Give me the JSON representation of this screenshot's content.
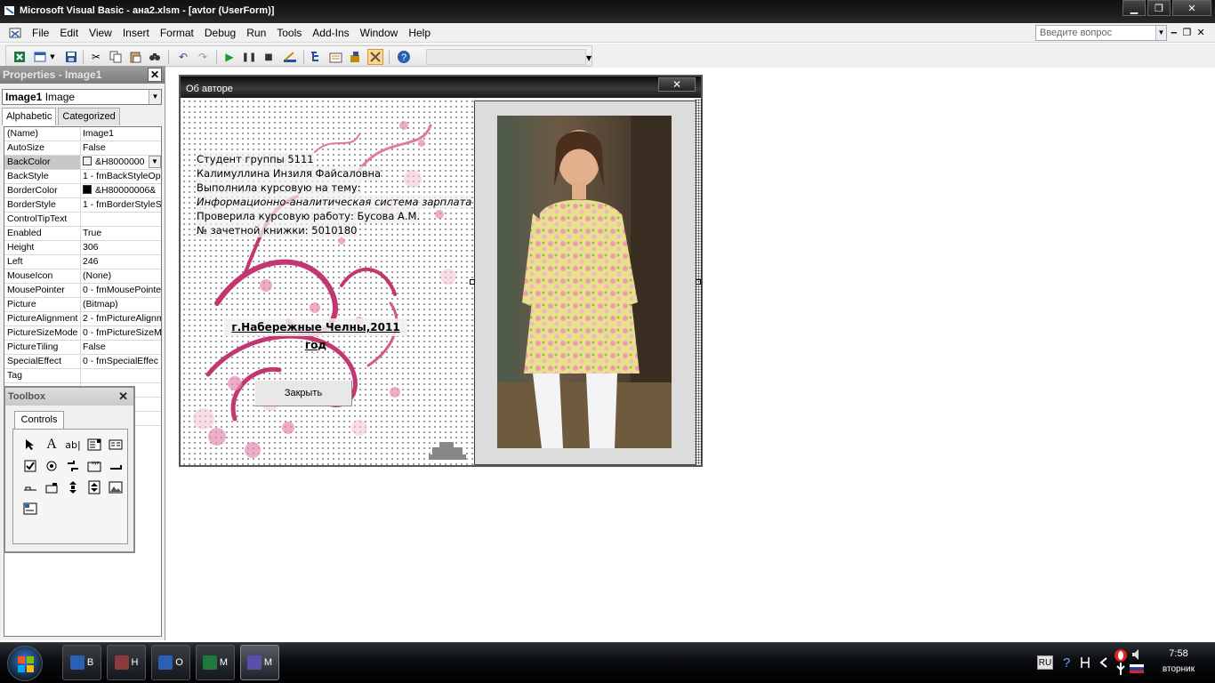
{
  "window": {
    "title": "Microsoft Visual Basic - ана2.xlsm - [avtor (UserForm)]",
    "min_label": "▁",
    "max_label": "❐",
    "close_label": "✕"
  },
  "menu": {
    "items": [
      "File",
      "Edit",
      "View",
      "Insert",
      "Format",
      "Debug",
      "Run",
      "Tools",
      "Add-Ins",
      "Window",
      "Help"
    ],
    "help_placeholder": "Введите вопрос",
    "mdi_min": "‒",
    "mdi_restore": "❐",
    "mdi_close": "✕"
  },
  "toolbar": {
    "icons": [
      "excel-icon",
      "insert-userform-icon",
      "save-icon",
      "cut-icon",
      "copy-icon",
      "paste-icon",
      "find-icon",
      "undo-icon",
      "redo-icon",
      "run-icon",
      "break-icon",
      "reset-icon",
      "design-mode-icon",
      "project-explorer-icon",
      "properties-icon",
      "object-browser-icon",
      "toolbox-icon",
      "help-icon"
    ]
  },
  "properties": {
    "header": "Properties - Image1",
    "close": "✕",
    "object_name": "Image1",
    "object_type": "Image",
    "tabs": [
      "Alphabetic",
      "Categorized"
    ],
    "rows": [
      {
        "name": "(Name)",
        "value": "Image1"
      },
      {
        "name": "AutoSize",
        "value": "False"
      },
      {
        "name": "BackColor",
        "value": "&H8000000"
      },
      {
        "name": "BackStyle",
        "value": "1 - fmBackStyleOp"
      },
      {
        "name": "BorderColor",
        "value": "&H80000006&"
      },
      {
        "name": "BorderStyle",
        "value": "1 - fmBorderStyleS"
      },
      {
        "name": "ControlTipText",
        "value": ""
      },
      {
        "name": "Enabled",
        "value": "True"
      },
      {
        "name": "Height",
        "value": "306"
      },
      {
        "name": "Left",
        "value": "246"
      },
      {
        "name": "MouseIcon",
        "value": "(None)"
      },
      {
        "name": "MousePointer",
        "value": "0 - fmMousePointe"
      },
      {
        "name": "Picture",
        "value": "(Bitmap)"
      },
      {
        "name": "PictureAlignment",
        "value": "2 - fmPictureAlignm"
      },
      {
        "name": "PictureSizeMode",
        "value": "0 - fmPictureSizeM"
      },
      {
        "name": "PictureTiling",
        "value": "False"
      },
      {
        "name": "SpecialEffect",
        "value": "0 - fmSpecialEffec"
      },
      {
        "name": "Tag",
        "value": ""
      }
    ],
    "backcolor_swatch": "#f0f0f0",
    "bordercolor_swatch": "#000000"
  },
  "toolbox": {
    "title": "Toolbox",
    "close": "✕",
    "tab": "Controls",
    "tools": [
      "select-objects-icon",
      "label-tool-icon",
      "textbox-tool-icon",
      "combobox-tool-icon",
      "listbox-tool-icon",
      "checkbox-tool-icon",
      "optionbutton-tool-icon",
      "togglebutton-tool-icon",
      "frame-tool-icon",
      "commandbutton-tool-icon",
      "tabstrip-tool-icon",
      "multipage-tool-icon",
      "scrollbar-tool-icon",
      "spinbutton-tool-icon",
      "image-tool-icon",
      "refedit-tool-icon"
    ]
  },
  "form": {
    "caption": "Об авторе",
    "close": "✕",
    "lines": [
      "Студент группы 5111",
      "Калимуллина Инзиля Файсаловна",
      "Выполнила курсовую на тему:",
      "Информационно-аналитическая система зарплата",
      "Проверила курсовую работу: Бусова А.М.",
      "№ зачетной книжки: 5010180"
    ],
    "city_label": "г.Набережные Челны,2011 год",
    "close_button": "Закрыть"
  },
  "taskbar": {
    "tasks": [
      {
        "letter": "B",
        "color": "#2b5fb3"
      },
      {
        "letter": "H",
        "color": "#8a3b3b"
      },
      {
        "letter": "O",
        "color": "#2b5fb3"
      },
      {
        "letter": "M",
        "color": "#1e7a3c"
      },
      {
        "letter": "M",
        "color": "#5d4ea8"
      }
    ],
    "lang": "RU",
    "time": "7:58",
    "day": "вторник"
  }
}
